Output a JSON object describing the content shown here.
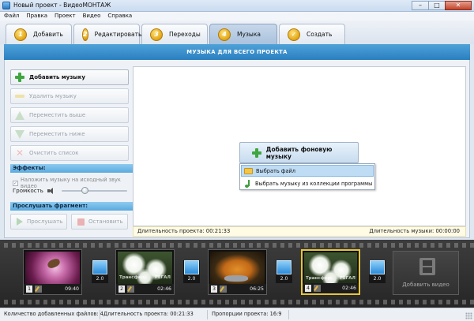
{
  "window": {
    "title": "Новый проект - ВидеоМОНТАЖ",
    "controls": [
      "–",
      "□",
      "✕"
    ]
  },
  "menu": [
    "Файл",
    "Правка",
    "Проект",
    "Видео",
    "Справка"
  ],
  "tabs": [
    {
      "num": "1",
      "label": "Добавить"
    },
    {
      "num": "2",
      "label": "Редактировать"
    },
    {
      "num": "3",
      "label": "Переходы"
    },
    {
      "num": "4",
      "label": "Музыка",
      "active": true
    },
    {
      "num": "✓",
      "label": "Создать"
    }
  ],
  "section_header": "МУЗЫКА ДЛЯ ВСЕГО ПРОЕКТА",
  "sidebar": {
    "add_music": "Добавить музыку",
    "remove_music": "Удалить музыку",
    "move_up": "Переместить выше",
    "move_down": "Переместить ниже",
    "clear_list": "Очистить список",
    "effects_header": "Эффекты:",
    "overlay_checkbox": "Наложить музыку на исходный звук видео",
    "overlay_checked": true,
    "volume_label": "Громкость",
    "volume_level": 0.35,
    "listen_header": "Прослушать фрагмент:",
    "listen_button": "Прослушать",
    "stop_button": "Остановить"
  },
  "music_area": {
    "add_background_button": "Добавить фоновую музыку",
    "dropdown": [
      "Выбрать файл",
      "Выбрать музыку из коллекции программы"
    ],
    "project_duration": "Длительность проекта:  00:21:33",
    "music_duration": "Длительность музыки:  00:00:00"
  },
  "timeline": {
    "clips": [
      {
        "num": "1",
        "duration": "09:40"
      },
      {
        "num": "2",
        "duration": "02:46",
        "watermark_left": "Трансфер",
        "watermark_right": "РЕГАЛ"
      },
      {
        "num": "3",
        "duration": "06:25"
      },
      {
        "num": "4",
        "duration": "02:46",
        "watermark_left": "Трансфер",
        "watermark_right": "РЕГАЛ"
      }
    ],
    "transitions": [
      "2.0",
      "2.0",
      "2.0",
      "2.0"
    ],
    "add_video_label": "Добавить видео"
  },
  "statusbar": {
    "files_count": "Количество добавленных файлов: 4",
    "project_duration": "Длительность проекта:  00:21:33",
    "aspect": "Пропорции проекта: 16:9"
  },
  "colors": {
    "header_blue": "#2a7fc0",
    "selected_clip_border": "#e6c53a",
    "tab_badge": "#e2a514"
  }
}
